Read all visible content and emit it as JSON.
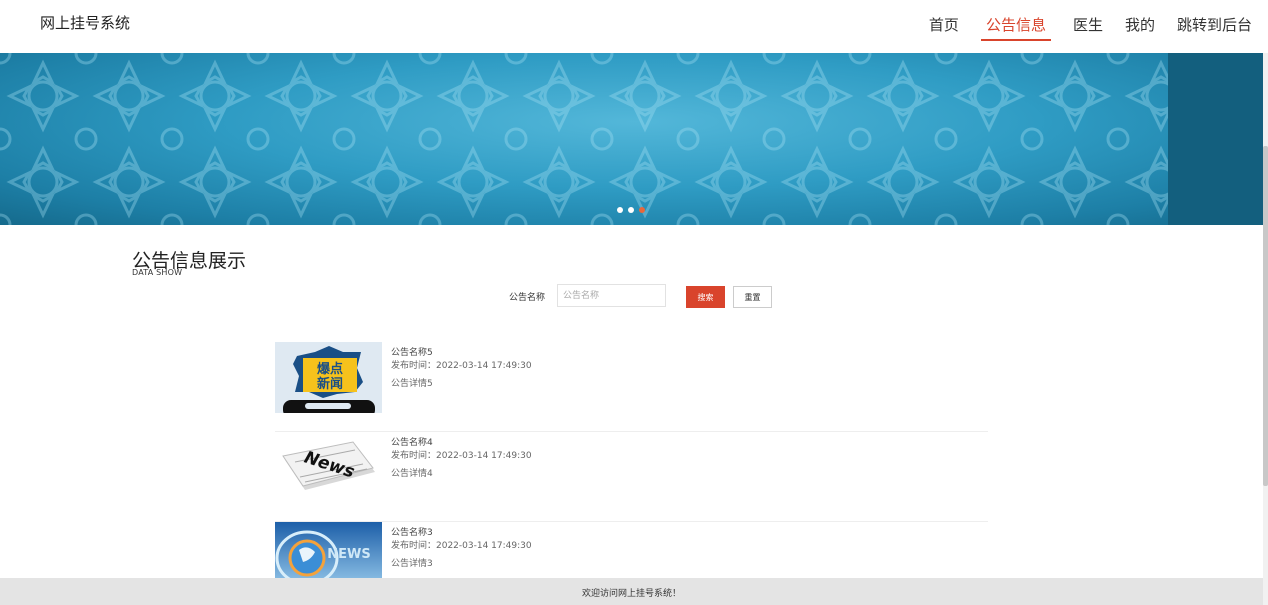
{
  "header": {
    "site_title": "网上挂号系统",
    "nav": [
      {
        "label": "首页",
        "active": false
      },
      {
        "label": "公告信息",
        "active": true
      },
      {
        "label": "医生",
        "active": false
      },
      {
        "label": "我的",
        "active": false
      },
      {
        "label": "跳转到后台",
        "active": false
      }
    ]
  },
  "banner": {
    "active_dot": 2,
    "dot_count": 3
  },
  "section": {
    "title": "公告信息展示",
    "subtitle": "DATA SHOW"
  },
  "search": {
    "label": "公告名称",
    "placeholder": "公告名称",
    "search_button": "搜索",
    "reset_button": "重置"
  },
  "items": [
    {
      "name": "公告名称5",
      "time": "发布时间：2022-03-14 17:49:30",
      "detail": "公告详情5",
      "image": "explosive-news-image",
      "image_text": [
        "爆点",
        "新闻"
      ]
    },
    {
      "name": "公告名称4",
      "time": "发布时间：2022-03-14 17:49:30",
      "detail": "公告详情4",
      "image": "newspaper-image",
      "image_text": [
        "News"
      ]
    },
    {
      "name": "公告名称3",
      "time": "发布时间：2022-03-14 17:49:30",
      "detail": "公告详情3",
      "image": "globe-news-image",
      "image_text": [
        "NEWS"
      ]
    }
  ],
  "footer": {
    "text": "欢迎访问网上挂号系统！"
  },
  "colors": {
    "accent": "#d9442c",
    "banner": "#2f9cc4",
    "footer_bg": "#e4e4e4"
  }
}
